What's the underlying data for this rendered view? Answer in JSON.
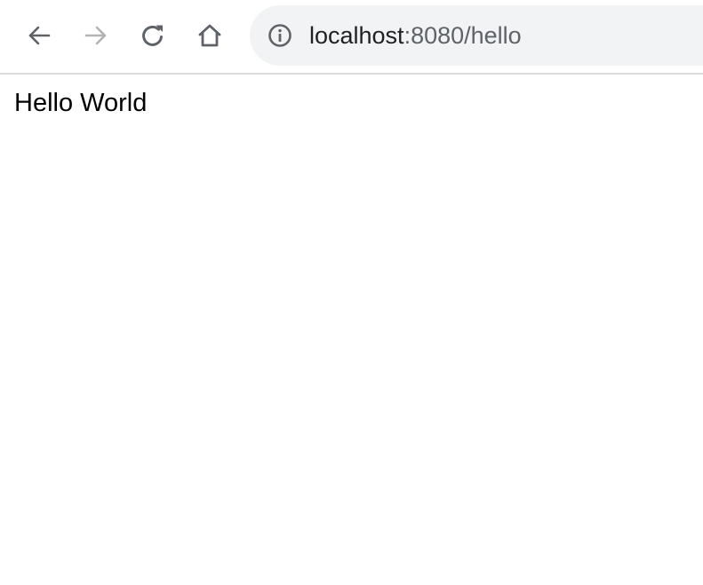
{
  "browser": {
    "toolbar": {
      "back_icon": "arrow-left-icon",
      "forward_icon": "arrow-right-icon",
      "reload_icon": "reload-icon",
      "home_icon": "home-icon",
      "icon_color": "#5f6368",
      "disabled_icon_color": "#b3b3b3"
    },
    "omnibox": {
      "site_info_icon": "info-circle-icon",
      "url_host": "localhost",
      "url_rest": ":8080/hello",
      "background": "#f1f3f4"
    }
  },
  "page": {
    "text": "Hello World"
  }
}
